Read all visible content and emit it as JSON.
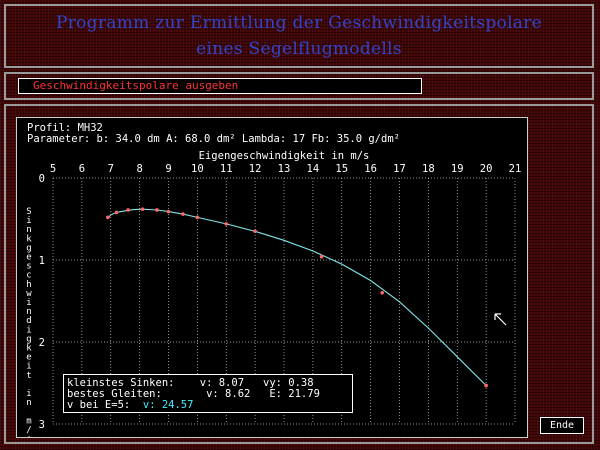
{
  "title": {
    "line1": "Programm zur Ermittlung der Geschwindigkeitspolare",
    "line2": "eines Segelflugmodells"
  },
  "menu": {
    "selected_item": "Geschwindigkeitspolare ausgeben"
  },
  "profile": {
    "line": "Profil:  MH32",
    "parameters": "Parameter:  b: 34.0 dm  A: 68.0 dm²  Lambda: 17  Fb: 35.0 g/dm²"
  },
  "chart_data": {
    "type": "line",
    "xlabel": "Eigengeschwindigkeit in m/s",
    "ylabel": "Sinkgeschwindigkeit in m/s",
    "x_ticks": [
      5,
      6,
      7,
      8,
      9,
      10,
      11,
      12,
      13,
      14,
      15,
      16,
      17,
      18,
      19,
      20,
      21
    ],
    "y_ticks": [
      0,
      1,
      2,
      3
    ],
    "xlim": [
      5,
      21
    ],
    "ylim": [
      0,
      3
    ],
    "y_inverted": true,
    "grid": true,
    "series": [
      {
        "points_x": [
          6.9,
          7.0,
          7.2,
          7.5,
          7.8,
          8.1,
          8.6,
          9.0,
          9.5,
          10.0,
          10.5,
          11.0,
          12.0,
          13.0,
          14.0,
          15.0,
          16.0,
          17.0,
          18.0,
          19.0,
          20.0
        ],
        "points_y": [
          0.49,
          0.45,
          0.42,
          0.4,
          0.385,
          0.38,
          0.39,
          0.41,
          0.44,
          0.48,
          0.52,
          0.56,
          0.65,
          0.76,
          0.89,
          1.05,
          1.25,
          1.51,
          1.83,
          2.18,
          2.53
        ],
        "markers_x": [
          6.9,
          7.2,
          7.6,
          8.1,
          8.6,
          9.0,
          9.5,
          10.0,
          11.0,
          12.0,
          14.3,
          16.4,
          20.0
        ],
        "markers_y": [
          0.48,
          0.42,
          0.39,
          0.38,
          0.39,
          0.41,
          0.44,
          0.48,
          0.56,
          0.65,
          0.96,
          1.4,
          2.53
        ],
        "line_color": "#7fe6ea",
        "marker_color": "#ff6666"
      }
    ]
  },
  "info": {
    "min_sink_label": "kleinstes Sinken:",
    "min_sink_v": "v: 8.07",
    "min_sink_vy": "vy: 0.38",
    "best_glide_label": "bestes Gleiten:",
    "best_glide_v": "v: 8.62",
    "best_glide_e": "E: 21.79",
    "e5_label": "v bei E=5:",
    "e5_v": "v: 24.57"
  },
  "end_button": "Ende",
  "colors": {
    "title": "#3344cc",
    "menu_text": "#ff3333",
    "value_cyan": "#40f0ff",
    "background": "#3c0606"
  }
}
